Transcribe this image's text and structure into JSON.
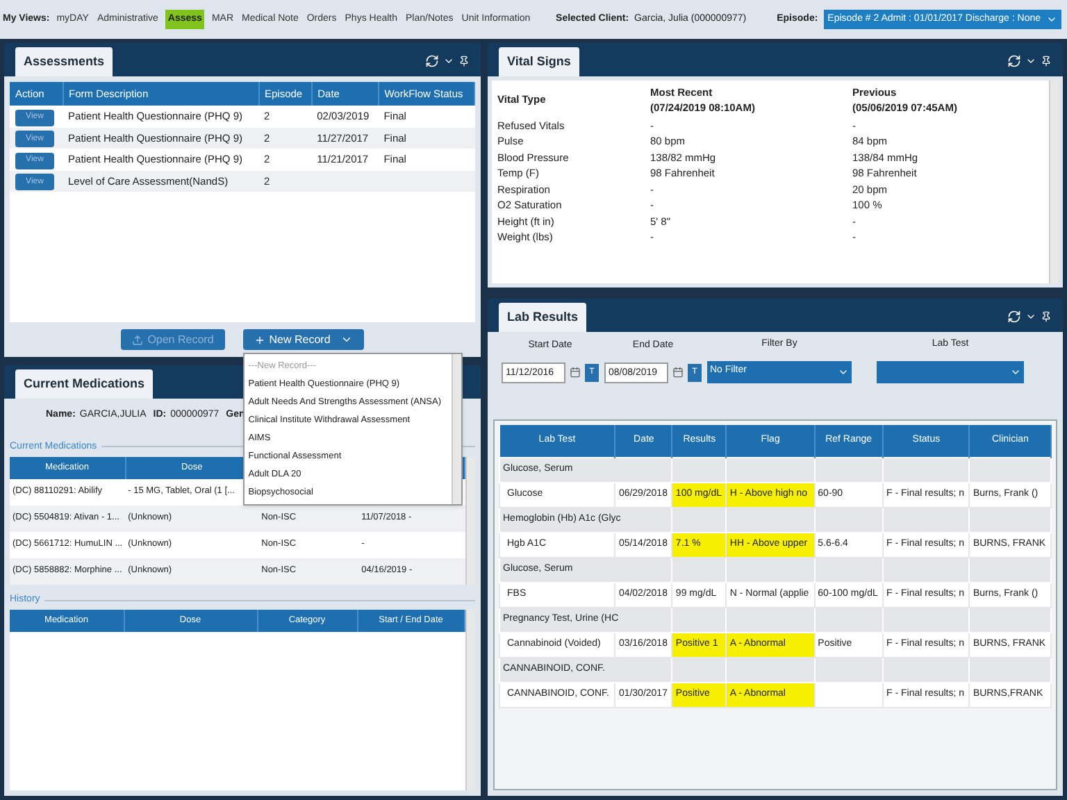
{
  "nav": {
    "label": "My Views:",
    "items": [
      {
        "label": "myDAY",
        "selected": false
      },
      {
        "label": "Administrative",
        "selected": false
      },
      {
        "label": "Assess",
        "selected": true
      },
      {
        "label": "MAR",
        "selected": false
      },
      {
        "label": "Medical Note",
        "selected": false
      },
      {
        "label": "Orders",
        "selected": false
      },
      {
        "label": "Phys Health",
        "selected": false
      },
      {
        "label": "Plan/Notes",
        "selected": false
      },
      {
        "label": "Unit Information",
        "selected": false
      }
    ],
    "client_label": "Selected Client:",
    "client": "Garcia, Julia (000000977)",
    "episode_label": "Episode:",
    "episode": "Episode # 2 Admit : 01/01/2017 Discharge : None"
  },
  "assessments": {
    "title": "Assessments",
    "columns": [
      "Action",
      "Form Description",
      "Episode",
      "Date",
      "WorkFlow Status"
    ],
    "rows": [
      {
        "action": "View",
        "form": "Patient Health Questionnaire (PHQ 9)",
        "episode": "2",
        "date": "02/03/2019",
        "status": "Final"
      },
      {
        "action": "View",
        "form": "Patient Health Questionnaire (PHQ 9)",
        "episode": "2",
        "date": "11/27/2017",
        "status": "Final"
      },
      {
        "action": "View",
        "form": "Patient Health Questionnaire (PHQ 9)",
        "episode": "2",
        "date": "11/21/2017",
        "status": "Final"
      },
      {
        "action": "View",
        "form": "Level of Care Assessment(NandS)",
        "episode": "2"
      }
    ],
    "buttons": [
      {
        "label": "Open Record",
        "disabled": true,
        "kind": "open"
      },
      {
        "label": "New Record",
        "disabled": false,
        "kind": "new"
      }
    ],
    "menu": [
      {
        "label": "---New Record---",
        "kind": "placeholder"
      },
      {
        "label": "Patient Health Questionnaire (PHQ 9)",
        "kind": "option"
      },
      {
        "label": "Adult Needs And Strengths Assessment (ANSA)",
        "kind": "option"
      },
      {
        "label": "Clinical Institute Withdrawal Assessment",
        "kind": "option"
      },
      {
        "label": "AIMS",
        "kind": "option"
      },
      {
        "label": "Functional Assessment",
        "kind": "option"
      },
      {
        "label": "Adult DLA 20",
        "kind": "option"
      },
      {
        "label": "Biopsychosocial",
        "kind": "option"
      }
    ]
  },
  "medications": {
    "title": "Current Medications",
    "name_label": "Name:",
    "name": "GARCIA,JULIA",
    "id_label": "ID:",
    "id": "000000977",
    "gender_label": "Gen",
    "current": {
      "legend": "Current Medications",
      "columns": [
        "Medication",
        "Dose"
      ],
      "rows": [
        {
          "medication": "(DC) 88110291: Abilify",
          "dose": "- 15 MG, Tablet, Oral (1 [..."
        },
        {
          "medication": "(DC) 5504819: Ativan - 1...",
          "dose": "(Unknown)",
          "category": "Non-ISC",
          "dates": "11/07/2018 -"
        },
        {
          "medication": "(DC) 5661712: HumuLIN ...",
          "dose": "(Unknown)",
          "category": "Non-ISC",
          "dates": "-"
        },
        {
          "medication": "(DC) 5858882: Morphine ...",
          "dose": "(Unknown)",
          "category": "Non-ISC",
          "dates": "04/16/2019 -"
        }
      ]
    },
    "history": {
      "legend": "History",
      "columns": [
        "Medication",
        "Dose",
        "Category",
        "Start / End Date"
      ]
    }
  },
  "vitals": {
    "title": "Vital Signs",
    "columns": [
      {
        "title": "Vital Type"
      },
      {
        "title": "Most Recent",
        "sub": "(07/24/2019 08:10AM)"
      },
      {
        "title": "Previous",
        "sub": "(05/06/2019 07:45AM)"
      }
    ],
    "rows": [
      [
        "Refused Vitals",
        "-",
        "-"
      ],
      [
        "Pulse",
        "80 bpm",
        "84 bpm"
      ],
      [
        "Blood Pressure",
        "138/82 mmHg",
        "138/84 mmHg"
      ],
      [
        "Temp (F)",
        "98 Fahrenheit",
        "98 Fahrenheit"
      ],
      [
        "Respiration",
        "-",
        "20 bpm"
      ],
      [
        "O2 Saturation",
        "-",
        "100 %"
      ],
      [
        "Height (ft in)",
        "5' 8\"",
        "-"
      ],
      [
        "Weight (lbs)",
        "-",
        "-"
      ]
    ]
  },
  "lab": {
    "title": "Lab Results",
    "dates": [
      {
        "label": "Start Date",
        "value": "11/12/2016",
        "button": "T"
      },
      {
        "label": "End Date",
        "value": "08/08/2019",
        "button": "T"
      }
    ],
    "filter_label": "Filter By",
    "filter": "No Filter",
    "test_label": "Lab Test",
    "columns": [
      "Lab Test",
      "Date",
      "Results",
      "Flag",
      "Ref Range",
      "Status",
      "Clinician"
    ],
    "rows": [
      {
        "kind": "group",
        "label": "Glucose, Serum"
      },
      {
        "kind": "result",
        "abnormal": true,
        "cells": [
          "Glucose",
          "06/29/2018",
          "100 mg/dL",
          "H - Above high no",
          "60-90",
          "F - Final results; n",
          "Burns, Frank ()"
        ]
      },
      {
        "kind": "group",
        "label": "Hemoglobin (Hb) A1c (Glyc"
      },
      {
        "kind": "result",
        "abnormal": true,
        "cells": [
          "Hgb A1C",
          "05/14/2018",
          "7.1 %",
          "HH - Above upper",
          "5.6-6.4",
          "F - Final results; n",
          "BURNS, FRANK"
        ]
      },
      {
        "kind": "group",
        "label": "Glucose, Serum"
      },
      {
        "kind": "result",
        "abnormal": false,
        "cells": [
          "FBS",
          "04/02/2018",
          "99 mg/dL",
          "N - Normal (applie",
          "60-100 mg/dL",
          "F - Final results; n",
          "Burns, Frank ()"
        ]
      },
      {
        "kind": "group",
        "label": "Pregnancy Test, Urine (HC"
      },
      {
        "kind": "result",
        "abnormal": true,
        "cells": [
          "Cannabinoid (Voided)",
          "03/16/2018",
          "Positive 1",
          "A - Abnormal",
          "Positive",
          "F - Final results; n",
          "BURNS, FRANK"
        ]
      },
      {
        "kind": "group",
        "label": "CANNABINOID, CONF."
      },
      {
        "kind": "result",
        "abnormal": true,
        "cells": [
          "CANNABINOID, CONF.",
          "01/30/2017",
          "Positive",
          "A - Abnormal",
          "",
          "F - Final results; n",
          "BURNS,FRANK"
        ]
      }
    ]
  }
}
